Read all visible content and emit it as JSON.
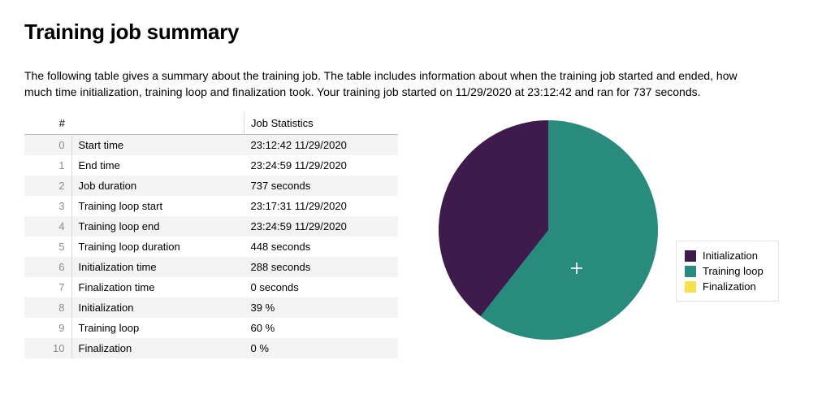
{
  "header": {
    "title": "Training job summary"
  },
  "description": "The following table gives a summary about the training job. The table includes information about when the training job started and ended, how much time initialization, training loop and finalization took. Your training job started on 11/29/2020 at 23:12:42 and ran for 737 seconds.",
  "table": {
    "col_index_header": "#",
    "col_name_header": "",
    "col_value_header": "Job Statistics",
    "rows": [
      {
        "idx": "0",
        "name": "Start time",
        "value": "23:12:42 11/29/2020"
      },
      {
        "idx": "1",
        "name": "End time",
        "value": "23:24:59 11/29/2020"
      },
      {
        "idx": "2",
        "name": "Job duration",
        "value": "737 seconds"
      },
      {
        "idx": "3",
        "name": "Training loop start",
        "value": "23:17:31 11/29/2020"
      },
      {
        "idx": "4",
        "name": "Training loop end",
        "value": "23:24:59 11/29/2020"
      },
      {
        "idx": "5",
        "name": "Training loop duration",
        "value": "448 seconds"
      },
      {
        "idx": "6",
        "name": "Initialization time",
        "value": "288 seconds"
      },
      {
        "idx": "7",
        "name": "Finalization time",
        "value": "0 seconds"
      },
      {
        "idx": "8",
        "name": "Initialization",
        "value": "39 %"
      },
      {
        "idx": "9",
        "name": "Training loop",
        "value": "60 %"
      },
      {
        "idx": "10",
        "name": "Finalization",
        "value": "0 %"
      }
    ]
  },
  "chart_data": {
    "type": "pie",
    "title": "",
    "categories": [
      "Initialization",
      "Training loop",
      "Finalization"
    ],
    "values": [
      39,
      60,
      0
    ],
    "colors": [
      "#3f1a4c",
      "#298a7e",
      "#f5e050"
    ],
    "legend_position": "right"
  }
}
